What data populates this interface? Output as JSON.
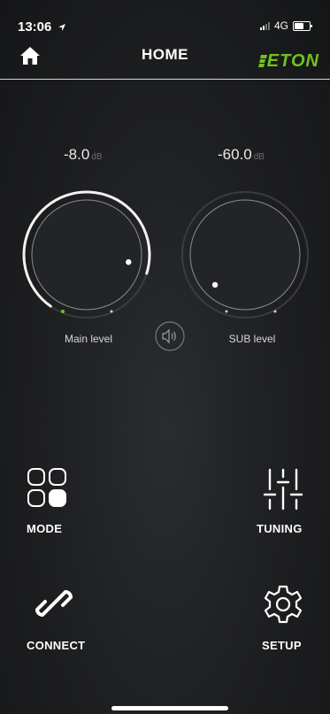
{
  "status": {
    "time": "13:06",
    "network": "4G"
  },
  "header": {
    "title": "HOME",
    "logo": "ETON"
  },
  "main_level": {
    "value": "-8.0",
    "unit": "dB",
    "label": "Main level",
    "fraction": 0.87
  },
  "sub_level": {
    "value": "-60.0",
    "unit": "dB",
    "label": "SUB level",
    "fraction": 0.0
  },
  "menu": {
    "mode": "MODE",
    "tuning": "TUNING",
    "connect": "CONNECT",
    "setup": "SETUP"
  },
  "colors": {
    "accent": "#6fc21f",
    "background": "#1f2022"
  }
}
